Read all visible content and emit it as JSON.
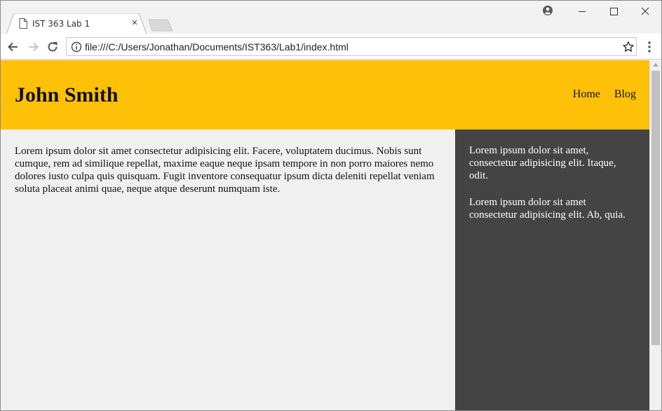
{
  "browser": {
    "tab_title": "IST 363 Lab 1",
    "tab_close": "×",
    "url": "file:///C:/Users/Jonathan/Documents/IST363/Lab1/index.html",
    "icons": {
      "doc": "document-icon",
      "close": "close-icon",
      "profile": "account-icon",
      "minimize": "minimize-icon",
      "maximize": "maximize-icon",
      "window_close": "window-close-icon",
      "back": "back-arrow-icon",
      "forward": "forward-arrow-icon",
      "reload": "reload-icon",
      "info": "info-icon",
      "bookmark": "star-icon",
      "menu": "kebab-menu-icon"
    }
  },
  "page": {
    "colors": {
      "header": "#ffc107",
      "sidebar": "#444444",
      "body": "#f0f0f0"
    },
    "header": {
      "title": "John Smith",
      "nav": [
        "Home",
        "Blog"
      ]
    },
    "main_text": "Lorem ipsum dolor sit amet consectetur adipisicing elit. Facere, voluptatem ducimus. Nobis sunt cumque, rem ad similique repellat, maxime eaque neque ipsam tempore in non porro maiores nemo dolores iusto culpa quis quisquam. Fugit inventore consequatur ipsum dicta deleniti repellat veniam soluta placeat animi quae, neque atque deserunt numquam iste.",
    "sidebar": [
      "Lorem ipsum dolor sit amet, consectetur adipisicing elit. Itaque, odit.",
      "Lorem ipsum dolor sit amet consectetur adipisicing elit. Ab, quia."
    ]
  }
}
